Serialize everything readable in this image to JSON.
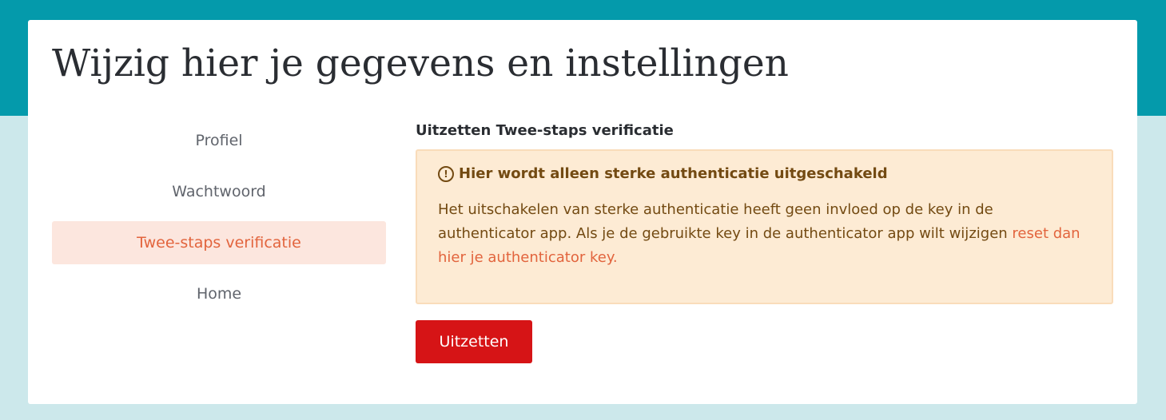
{
  "page": {
    "title": "Wijzig hier je gegevens en instellingen"
  },
  "sidebar": {
    "items": [
      {
        "label": "Profiel",
        "active": false
      },
      {
        "label": "Wachtwoord",
        "active": false
      },
      {
        "label": "Twee-staps verificatie",
        "active": true
      },
      {
        "label": "Home",
        "active": false
      }
    ]
  },
  "main": {
    "section_title": "Uitzetten Twee-staps verificatie",
    "alert": {
      "icon": "exclamation-circle-icon",
      "icon_glyph": "!",
      "title": "Hier wordt alleen sterke authenticatie uitgeschakeld",
      "body_text": "Het uitschakelen van sterke authenticatie heeft geen invloed op de key in de authenticator app. Als je de gebruikte key in de authenticator app wilt wijzigen",
      "link_text": "reset dan hier je authenticator key."
    },
    "submit_label": "Uitzetten"
  },
  "colors": {
    "header_band": "#049aab",
    "page_background": "#cce8eb",
    "active_nav_background": "#fce6de",
    "accent": "#e2643d",
    "alert_background": "#fdebd4",
    "alert_text": "#734a12",
    "danger_button": "#d61416"
  }
}
